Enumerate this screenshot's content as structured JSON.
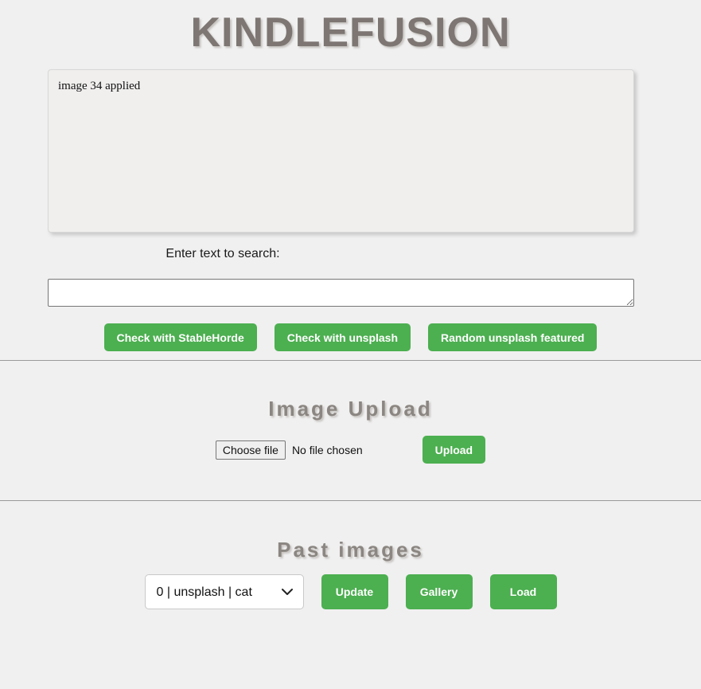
{
  "app": {
    "title": "KINDLEFUSION",
    "background_color": "#f0f0f0",
    "accent_color": "#4CAF50",
    "heading_color": "#7d7672"
  },
  "output": {
    "text": "image 34 applied"
  },
  "search": {
    "label": "Enter text to search:",
    "value": "",
    "placeholder": "",
    "buttons": [
      {
        "label": "Check with StableHorde",
        "name": "check-with-stablehorde-button"
      },
      {
        "label": "Check with unsplash",
        "name": "check-with-unsplash-button"
      },
      {
        "label": "Random unsplash featured",
        "name": "random-unsplash-featured-button"
      }
    ]
  },
  "upload": {
    "title": "Image Upload",
    "choose_file_label": "Choose file",
    "no_file_text": "No file chosen",
    "upload_label": "Upload"
  },
  "past": {
    "title": "Past images",
    "selected_option": "0 | unsplash | cat",
    "options": [
      "0 | unsplash | cat"
    ],
    "chevron_icon": "chevron-down-icon",
    "buttons": [
      {
        "label": "Update",
        "name": "update-button"
      },
      {
        "label": "Gallery",
        "name": "gallery-button"
      },
      {
        "label": "Load",
        "name": "load-button"
      }
    ]
  }
}
